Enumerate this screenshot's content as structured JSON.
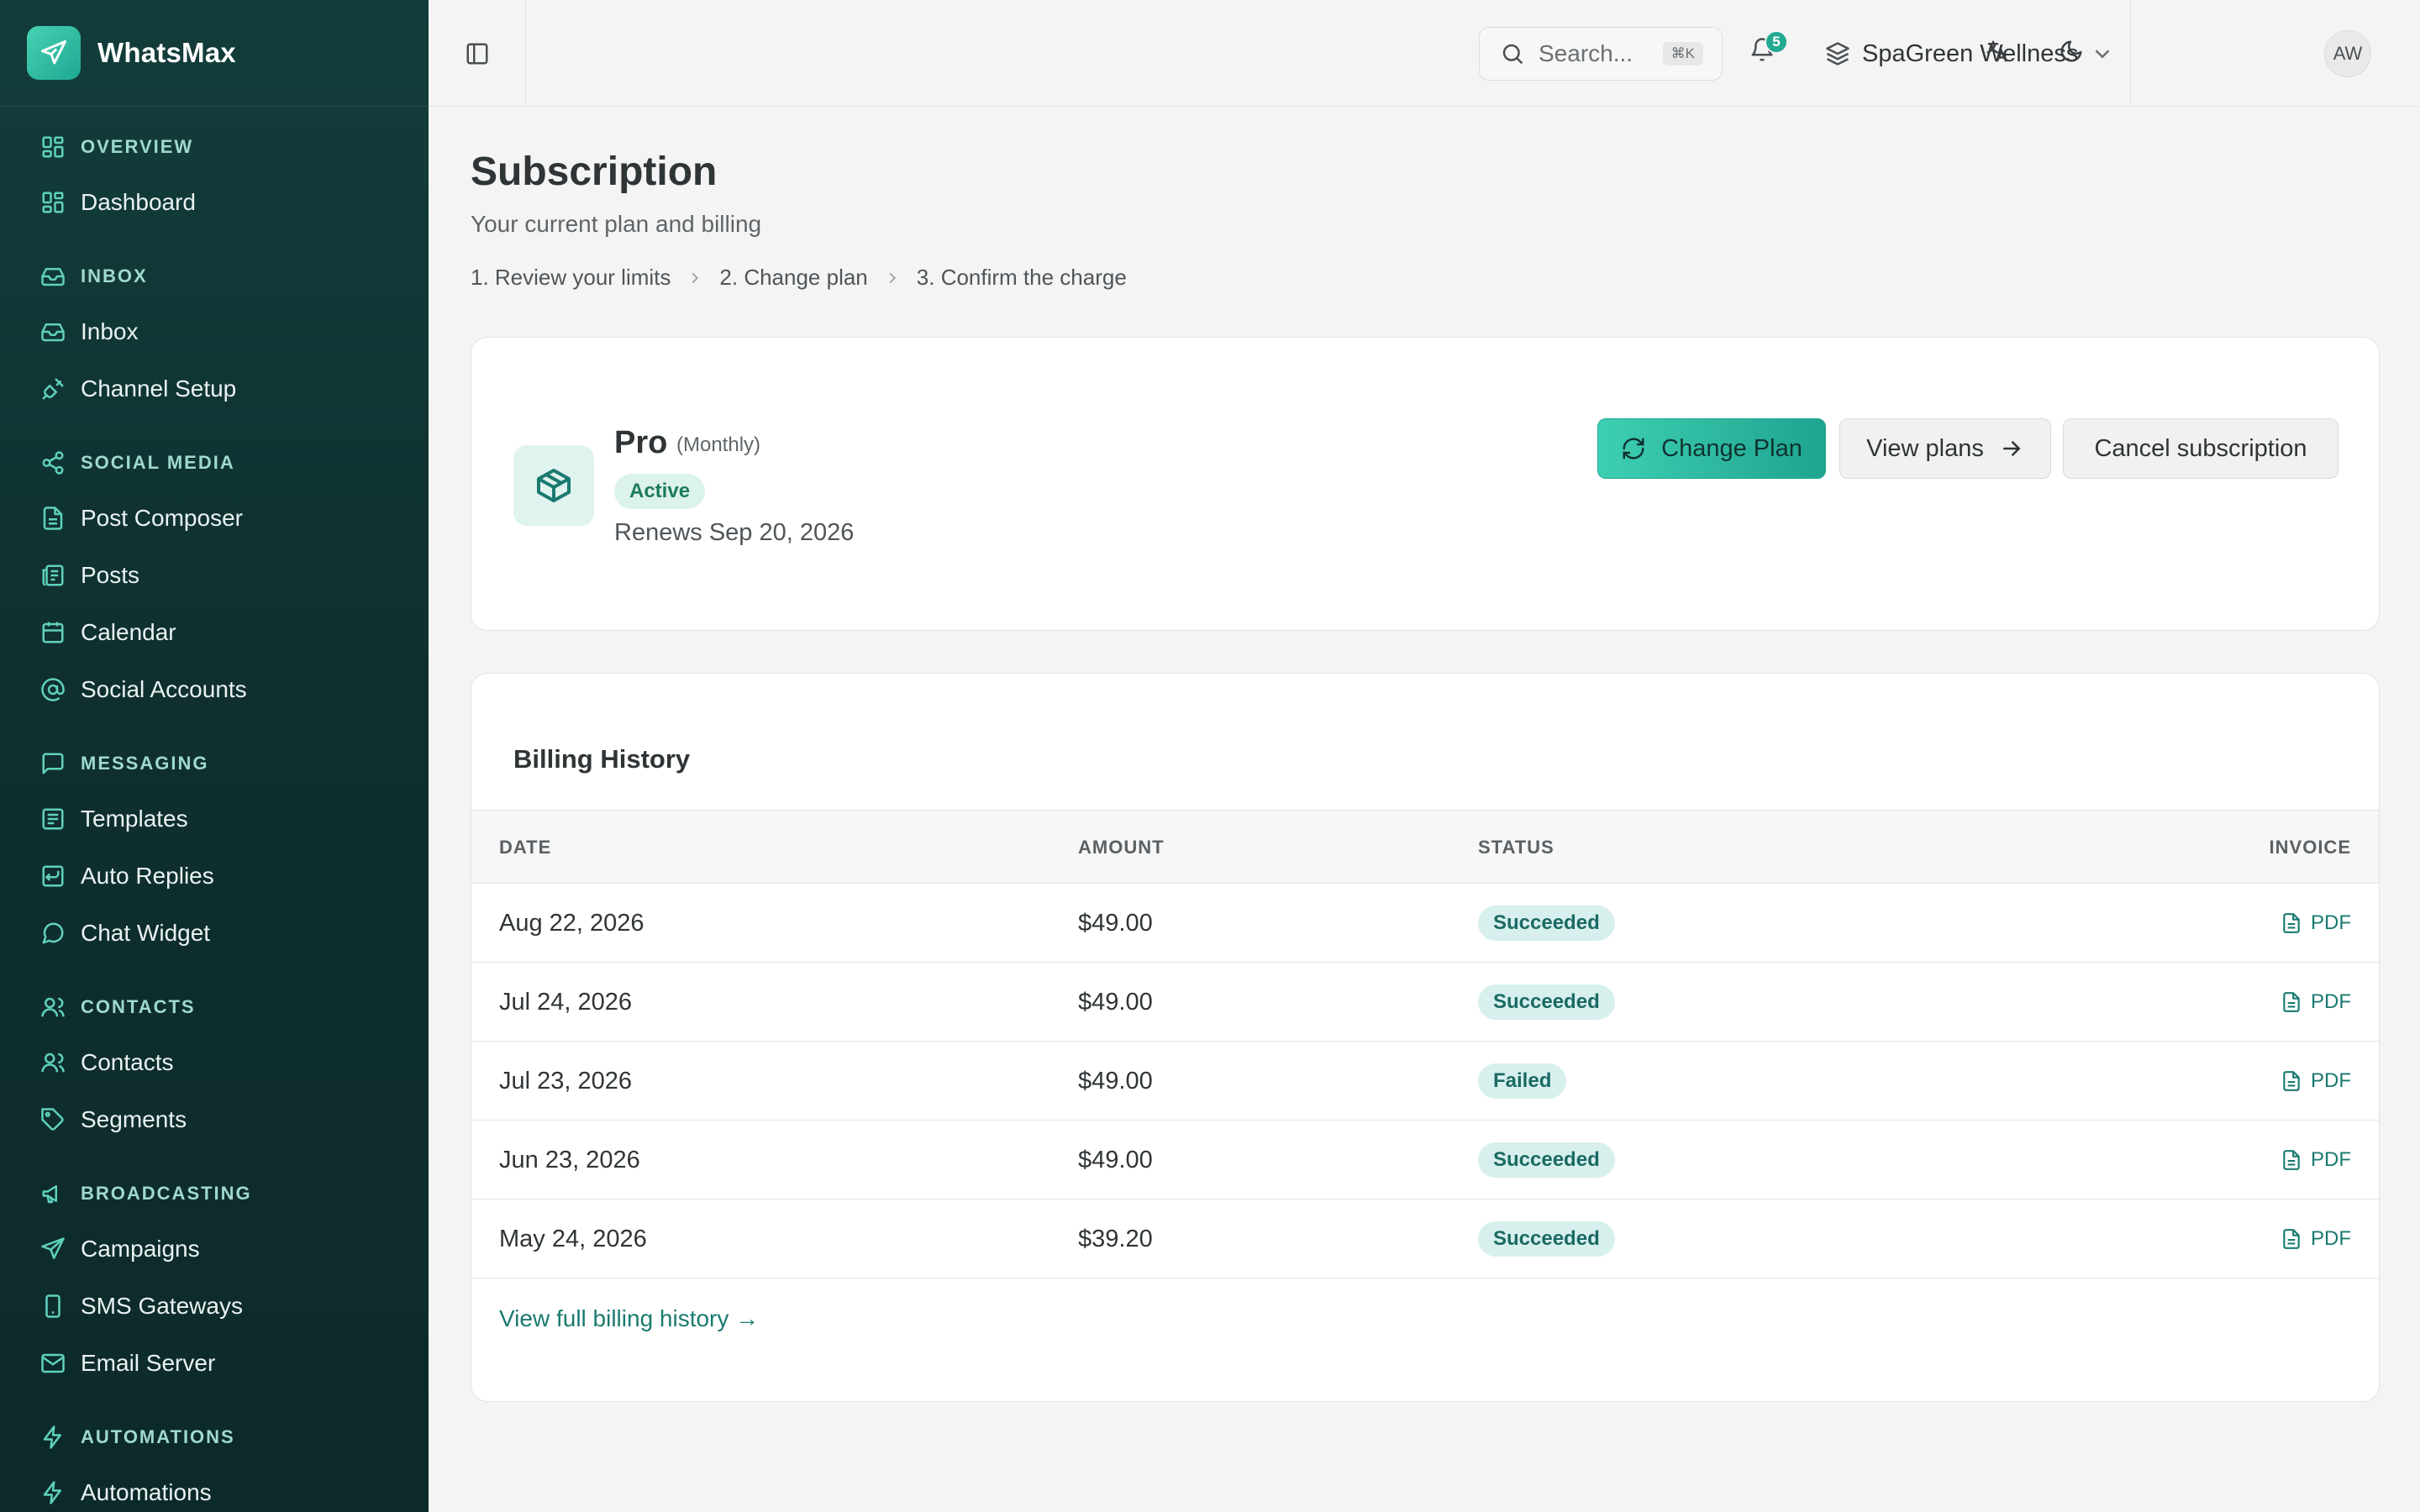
{
  "app": {
    "name": "WhatsMax"
  },
  "sidebar": {
    "sections": [
      {
        "label": "OVERVIEW",
        "items": [
          {
            "label": "Dashboard",
            "icon": "dashboard-icon"
          }
        ]
      },
      {
        "label": "INBOX",
        "items": [
          {
            "label": "Inbox",
            "icon": "inbox-icon"
          },
          {
            "label": "Channel Setup",
            "icon": "plug-icon"
          }
        ]
      },
      {
        "label": "SOCIAL MEDIA",
        "items": [
          {
            "label": "Post Composer",
            "icon": "document-icon"
          },
          {
            "label": "Posts",
            "icon": "newspaper-icon"
          },
          {
            "label": "Calendar",
            "icon": "calendar-icon"
          },
          {
            "label": "Social Accounts",
            "icon": "at-sign-icon"
          }
        ]
      },
      {
        "label": "MESSAGING",
        "items": [
          {
            "label": "Templates",
            "icon": "template-icon"
          },
          {
            "label": "Auto Replies",
            "icon": "auto-reply-icon"
          },
          {
            "label": "Chat Widget",
            "icon": "chat-bubble-icon"
          }
        ]
      },
      {
        "label": "CONTACTS",
        "items": [
          {
            "label": "Contacts",
            "icon": "users-icon"
          },
          {
            "label": "Segments",
            "icon": "tag-icon"
          }
        ]
      },
      {
        "label": "BROADCASTING",
        "items": [
          {
            "label": "Campaigns",
            "icon": "send-icon"
          },
          {
            "label": "SMS Gateways",
            "icon": "phone-icon"
          },
          {
            "label": "Email Server",
            "icon": "mail-icon"
          }
        ]
      },
      {
        "label": "AUTOMATIONS",
        "items": [
          {
            "label": "Automations",
            "icon": "bolt-icon"
          }
        ]
      }
    ]
  },
  "topbar": {
    "search_placeholder": "Search...",
    "search_shortcut": "⌘K",
    "notification_count": "5",
    "workspace": "SpaGreen Wellness",
    "avatar_initials": "AW"
  },
  "page": {
    "title": "Subscription",
    "subtitle": "Your current plan and billing",
    "steps": [
      "1.  Review your limits",
      "2.  Change plan",
      "3.  Confirm the charge"
    ]
  },
  "plan": {
    "name": "Pro",
    "cycle": "(Monthly)",
    "status": "Active",
    "renews": "Renews Sep 20, 2026",
    "change_label": "Change Plan",
    "view_label": "View plans",
    "cancel_label": "Cancel subscription"
  },
  "billing": {
    "title": "Billing History",
    "columns": {
      "date": "DATE",
      "amount": "AMOUNT",
      "status": "STATUS",
      "invoice": "INVOICE"
    },
    "rows": [
      {
        "date": "Aug 22, 2026",
        "amount": "$49.00",
        "status": "Succeeded",
        "invoice": "PDF"
      },
      {
        "date": "Jul 24, 2026",
        "amount": "$49.00",
        "status": "Succeeded",
        "invoice": "PDF"
      },
      {
        "date": "Jul 23, 2026",
        "amount": "$49.00",
        "status": "Failed",
        "invoice": "PDF"
      },
      {
        "date": "Jun 23, 2026",
        "amount": "$49.00",
        "status": "Succeeded",
        "invoice": "PDF"
      },
      {
        "date": "May 24, 2026",
        "amount": "$39.20",
        "status": "Succeeded",
        "invoice": "PDF"
      }
    ],
    "view_full": "View full billing history →"
  },
  "colors": {
    "accent": "#23a991",
    "sidebar": "#123d3b",
    "link": "#1a7a70"
  }
}
